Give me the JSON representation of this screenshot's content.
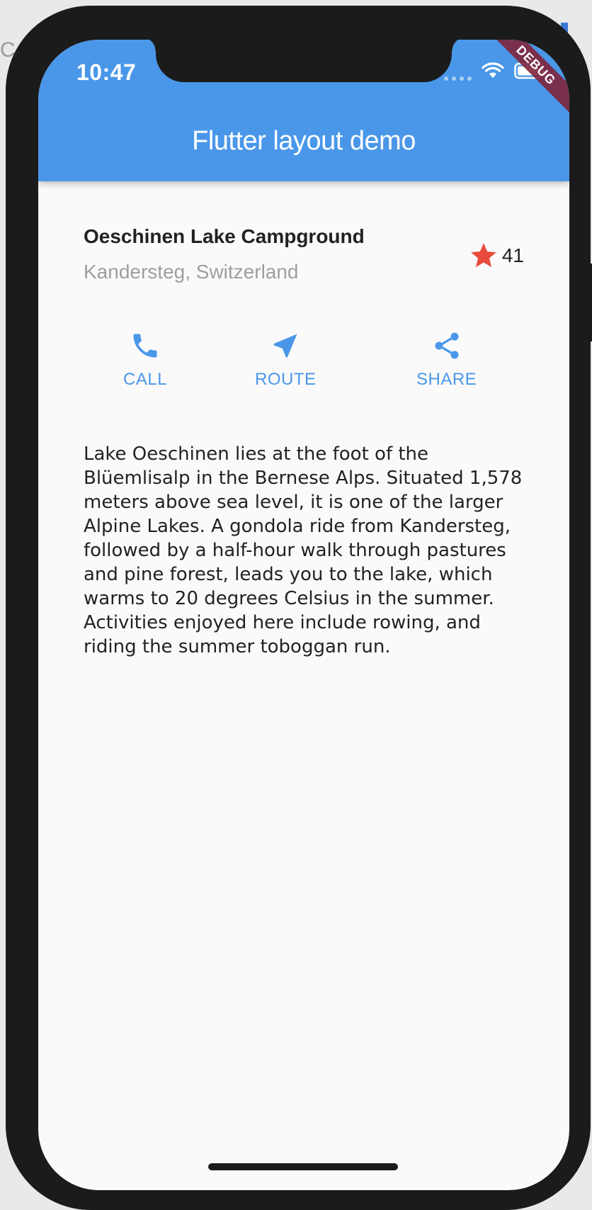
{
  "status": {
    "time": "10:47"
  },
  "appbar": {
    "title": "Flutter layout demo",
    "debug_banner": "DEBUG"
  },
  "place": {
    "name": "Oeschinen Lake Campground",
    "location": "Kandersteg, Switzerland",
    "rating_count": "41"
  },
  "actions": [
    {
      "label": "CALL",
      "icon": "phone-icon"
    },
    {
      "label": "ROUTE",
      "icon": "navigation-icon"
    },
    {
      "label": "SHARE",
      "icon": "share-icon"
    }
  ],
  "description": "Lake Oeschinen lies at the foot of the Blüemlisalp in the Bernese Alps. Situated 1,578 meters above sea level, it is one of the larger Alpine Lakes. A gondola ride from Kandersteg, followed by a half-hour walk through pastures and pine forest, leads you to the lake, which warms to 20 degrees Celsius in the summer. Activities enjoyed here include rowing, and riding the summer toboggan run.",
  "colors": {
    "appbar": "#4a97e9",
    "accent": "#4a97e9",
    "star": "#e84b3c",
    "background": "#fafafa",
    "debug_banner": "#80253c"
  },
  "background_peek": {
    "text": "C"
  }
}
